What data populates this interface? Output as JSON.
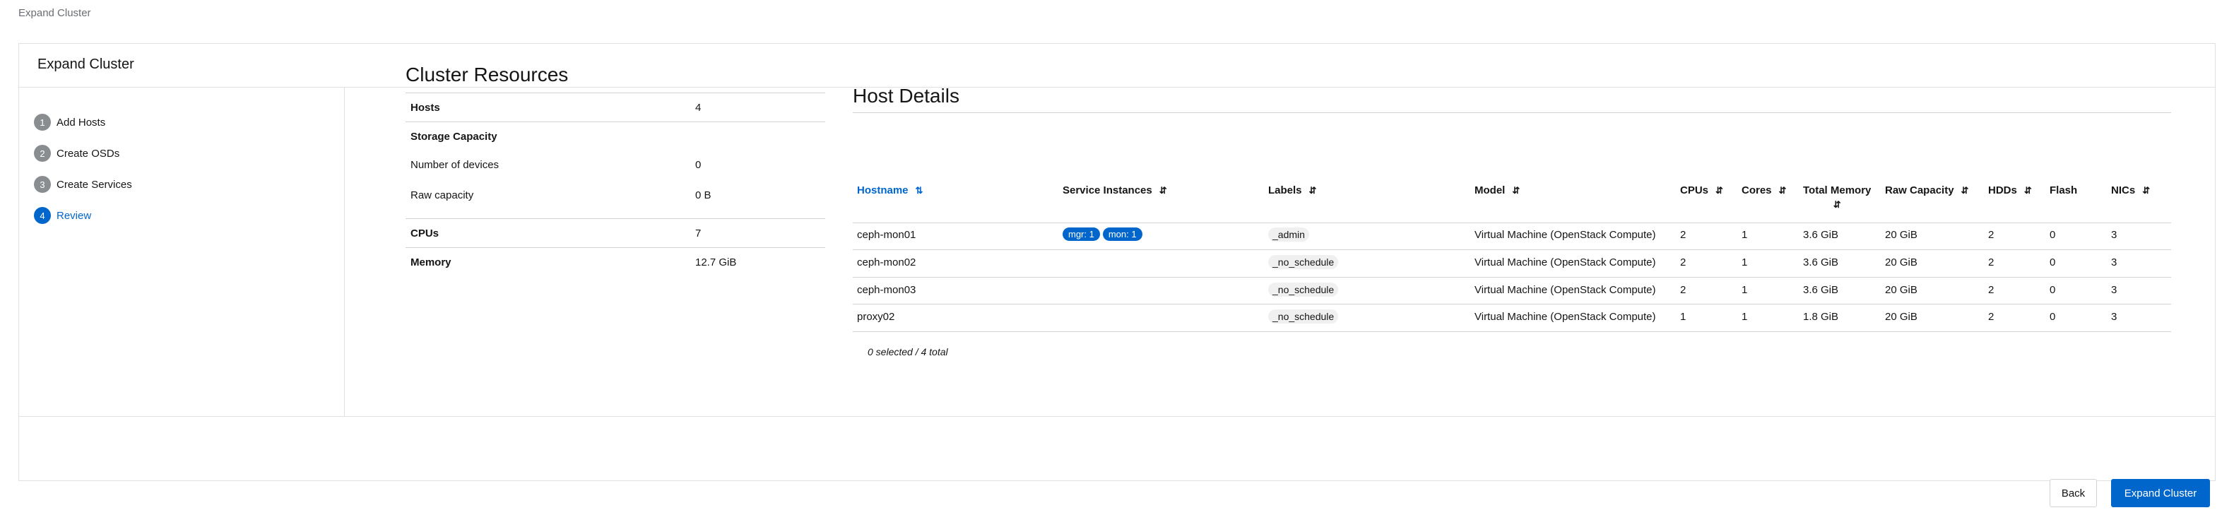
{
  "breadcrumb": "Expand Cluster",
  "card": {
    "title": "Expand Cluster"
  },
  "wizard_steps": [
    {
      "num": "1",
      "label": "Add Hosts"
    },
    {
      "num": "2",
      "label": "Create OSDs"
    },
    {
      "num": "3",
      "label": "Create Services"
    },
    {
      "num": "4",
      "label": "Review"
    }
  ],
  "current_step": 4,
  "cluster_resources": {
    "title": "Cluster Resources",
    "rows": [
      {
        "key": "Hosts",
        "value": "4"
      },
      {
        "key": "Storage Capacity",
        "value": ""
      },
      {
        "key": "Number of devices",
        "value": "0"
      },
      {
        "key": "Raw capacity",
        "value": "0 B"
      },
      {
        "key": "CPUs",
        "value": "7"
      },
      {
        "key": "Memory",
        "value": "12.7 GiB"
      }
    ]
  },
  "host_details": {
    "title": "Host Details",
    "columns": [
      "Hostname",
      "Service Instances",
      "Labels",
      "Model",
      "CPUs",
      "Cores",
      "Total Memory",
      "Raw Capacity",
      "HDDs",
      "Flash",
      "NICs"
    ],
    "rows": [
      {
        "hostname": "ceph-mon01",
        "services": [
          "mgr: 1",
          "mon: 1"
        ],
        "labels": [
          "_admin"
        ],
        "model": "Virtual Machine (OpenStack Compute)",
        "cpus": "2",
        "cores": "1",
        "memory": "3.6 GiB",
        "raw": "20 GiB",
        "hdds": "2",
        "flash": "0",
        "nics": "3"
      },
      {
        "hostname": "ceph-mon02",
        "services": [],
        "labels": [
          "_no_schedule"
        ],
        "model": "Virtual Machine (OpenStack Compute)",
        "cpus": "2",
        "cores": "1",
        "memory": "3.6 GiB",
        "raw": "20 GiB",
        "hdds": "2",
        "flash": "0",
        "nics": "3"
      },
      {
        "hostname": "ceph-mon03",
        "services": [],
        "labels": [
          "_no_schedule"
        ],
        "model": "Virtual Machine (OpenStack Compute)",
        "cpus": "2",
        "cores": "1",
        "memory": "3.6 GiB",
        "raw": "20 GiB",
        "hdds": "2",
        "flash": "0",
        "nics": "3"
      },
      {
        "hostname": "proxy02",
        "services": [],
        "labels": [
          "_no_schedule"
        ],
        "model": "Virtual Machine (OpenStack Compute)",
        "cpus": "1",
        "cores": "1",
        "memory": "1.8 GiB",
        "raw": "20 GiB",
        "hdds": "2",
        "flash": "0",
        "nics": "3"
      }
    ],
    "selection_summary": "0 selected / 4 total"
  },
  "footer": {
    "back_label": "Back",
    "submit_label": "Expand Cluster"
  },
  "colors": {
    "accent": "#0066cc",
    "step_inactive": "#8a8d90",
    "border": "#d2d2d2"
  }
}
